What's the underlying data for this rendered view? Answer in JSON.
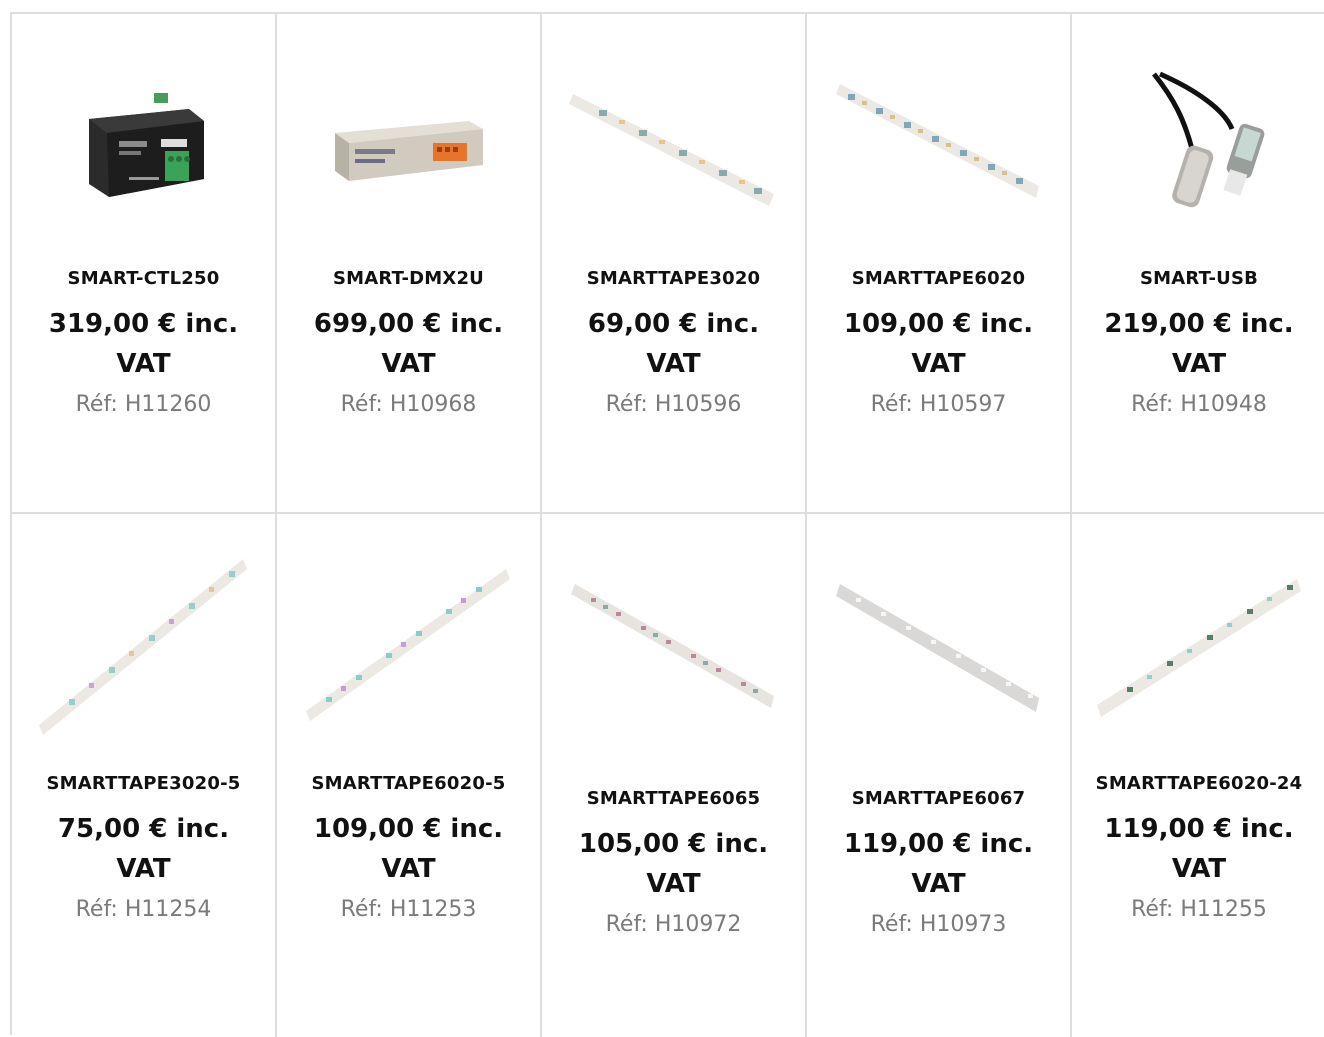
{
  "products": [
    {
      "name": "SMART-CTL250",
      "price": "319,00 € inc. VAT",
      "ref": "Réf: H11260",
      "image": "controller-box-icon"
    },
    {
      "name": "SMART-DMX2U",
      "price": "699,00 € inc. VAT",
      "ref": "Réf: H10968",
      "image": "dmx-interface-icon"
    },
    {
      "name": "SMARTTAPE3020",
      "price": "69,00 € inc. VAT",
      "ref": "Réf: H10596",
      "image": "led-tape-icon"
    },
    {
      "name": "SMARTTAPE6020",
      "price": "109,00 € inc. VAT",
      "ref": "Réf: H10597",
      "image": "led-tape-icon"
    },
    {
      "name": "SMART-USB",
      "price": "219,00 € inc. VAT",
      "ref": "Réf: H10948",
      "image": "usb-dmx-cable-icon"
    },
    {
      "name": "SMARTTAPE3020-5",
      "price": "75,00 € inc. VAT",
      "ref": "Réf: H11254",
      "image": "led-tape-icon"
    },
    {
      "name": "SMARTTAPE6020-5",
      "price": "109,00 € inc. VAT",
      "ref": "Réf: H11253",
      "image": "led-tape-icon"
    },
    {
      "name": "SMARTTAPE6065",
      "price": "105,00 € inc. VAT",
      "ref": "Réf: H10972",
      "image": "led-tape-icon"
    },
    {
      "name": "SMARTTAPE6067",
      "price": "119,00 € inc. VAT",
      "ref": "Réf: H10973",
      "image": "led-tape-icon"
    },
    {
      "name": "SMARTTAPE6020-24",
      "price": "119,00 € inc. VAT",
      "ref": "Réf: H11255",
      "image": "led-tape-icon"
    }
  ],
  "colors": {
    "border": "#dedede",
    "ref_text": "#7a7a7a",
    "name_text": "#111111"
  }
}
